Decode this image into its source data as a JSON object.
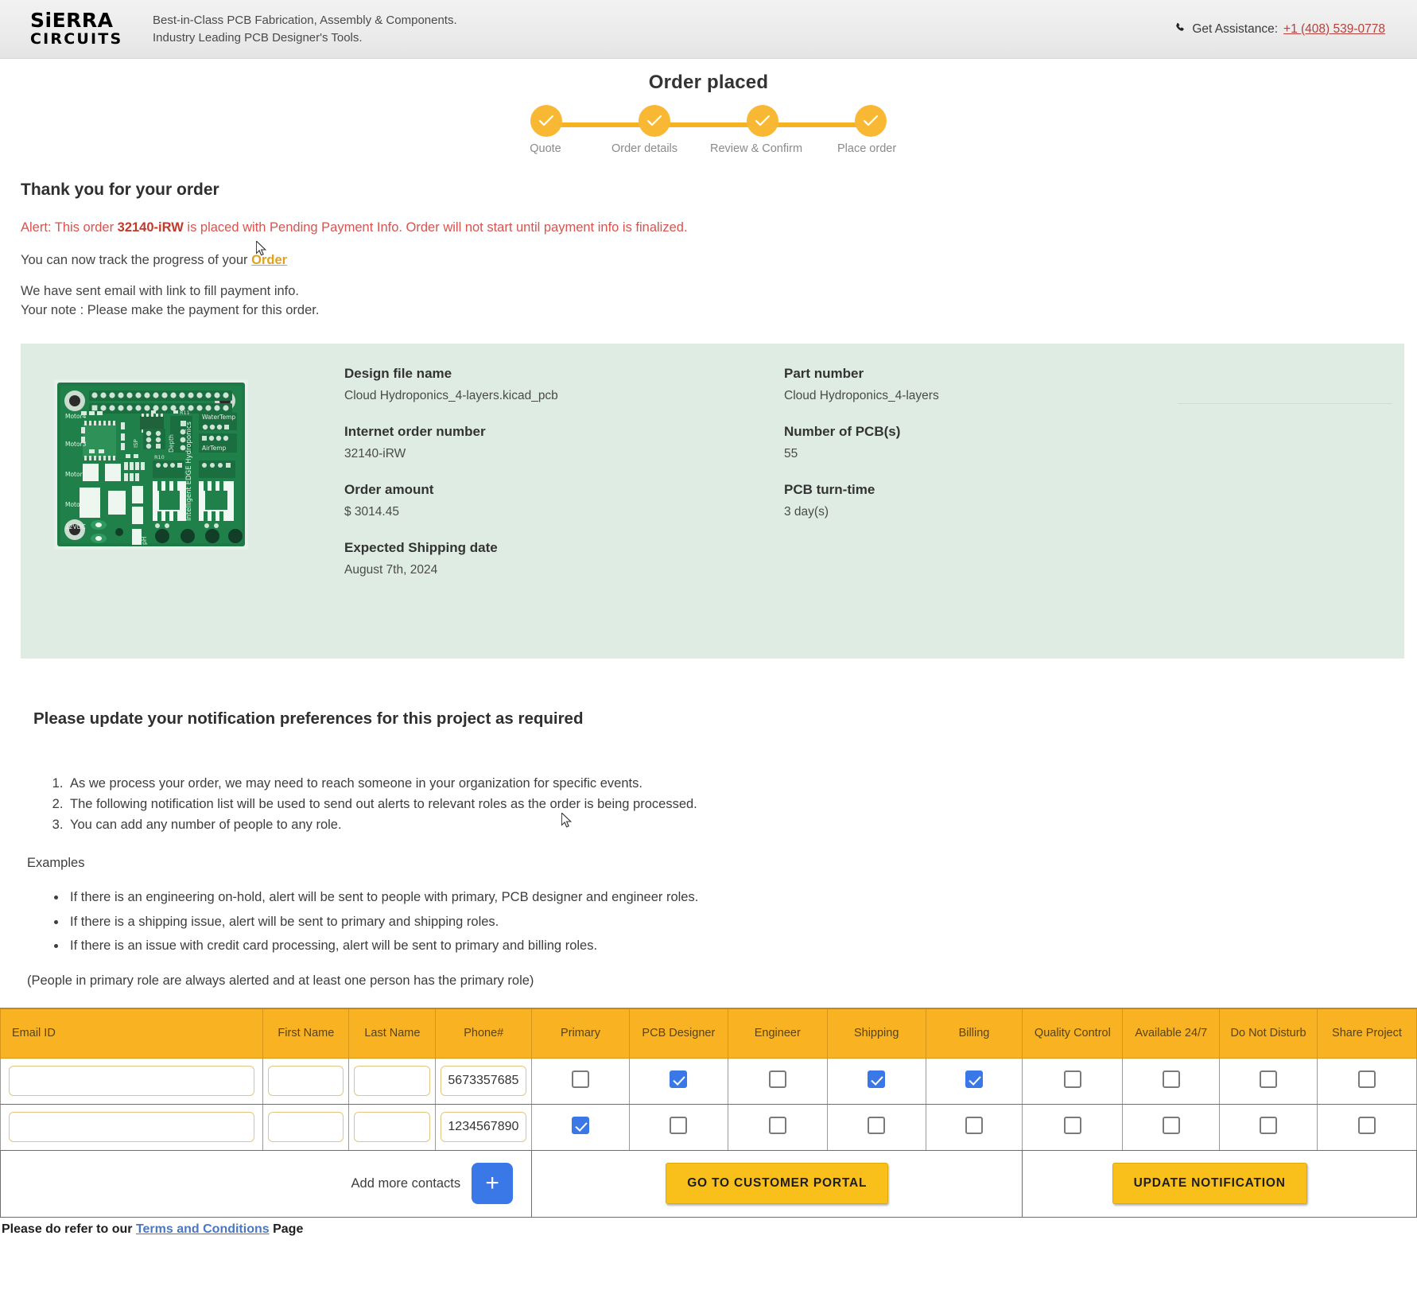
{
  "header": {
    "logo_line1": "SiERRA",
    "logo_line2": "CIRCUITS",
    "tagline_1": "Best-in-Class PCB Fabrication, Assembly & Components.",
    "tagline_2": "Industry Leading PCB Designer's Tools.",
    "assist_label": "Get Assistance:",
    "assist_phone": "+1 (408) 539-0778",
    "phone_icon": "phone-icon"
  },
  "stepper": {
    "title": "Order placed",
    "steps": [
      {
        "label": "Quote",
        "complete": true
      },
      {
        "label": "Order details",
        "complete": true
      },
      {
        "label": "Review & Confirm",
        "complete": true
      },
      {
        "label": "Place order",
        "complete": true
      }
    ]
  },
  "summary": {
    "thanks_heading": "Thank you for your order",
    "alert_prefix": "Alert: This order ",
    "alert_order_id": "32140-iRW",
    "alert_suffix": " is placed with Pending Payment Info. Order will not start until payment info is finalized.",
    "track_prefix": "You can now track the progress of your ",
    "track_link": "Order",
    "email_line": "We have sent email with link to fill payment info.",
    "note_line": "Your note : Please make the payment for this order."
  },
  "details": {
    "left": [
      {
        "label": "Design file name",
        "value": "Cloud Hydroponics_4-layers.kicad_pcb"
      },
      {
        "label": "Internet order number",
        "value": "32140-iRW"
      },
      {
        "label": "Order amount",
        "value": "$ 3014.45"
      },
      {
        "label": "Expected Shipping date",
        "value": "August 7th, 2024"
      }
    ],
    "right": [
      {
        "label": "Part number",
        "value": "Cloud Hydroponics_4-layers"
      },
      {
        "label": "Number of PCB(s)",
        "value": "55"
      },
      {
        "label": "PCB turn-time",
        "value": "3 day(s)"
      }
    ],
    "thumbnail_name": "pcb-board-preview-image"
  },
  "preferences": {
    "title": "Please update your notification preferences for this project as required",
    "numbered": [
      "As we process your order, we may need to reach someone in your organization for specific events.",
      "The following notification list will be used to send out alerts to relevant roles as the order is being processed.",
      "You can add any number of people to any role."
    ],
    "examples_heading": "Examples",
    "examples": [
      "If there is an engineering on-hold, alert will be sent to people with primary, PCB designer and engineer roles.",
      "If there is a shipping issue, alert will be sent to primary and shipping roles.",
      "If there is an issue with credit card processing, alert will be sent to primary and billing roles."
    ],
    "primary_note": "(People in primary role are always alerted and at least one person has the primary role)"
  },
  "table": {
    "columns": [
      "Email ID",
      "First Name",
      "Last Name",
      "Phone#",
      "Primary",
      "PCB Designer",
      "Engineer",
      "Shipping",
      "Billing",
      "Quality Control",
      "Available 24/7",
      "Do Not Disturb",
      "Share Project"
    ],
    "rows": [
      {
        "email": "",
        "first_name": "",
        "last_name": "",
        "phone": "5673357685",
        "primary": false,
        "pcb_designer": true,
        "engineer": false,
        "shipping": true,
        "billing": true,
        "quality_control": false,
        "available_247": false,
        "do_not_disturb": false,
        "share_project": false
      },
      {
        "email": "",
        "first_name": "",
        "last_name": "",
        "phone": "1234567890",
        "primary": true,
        "pcb_designer": false,
        "engineer": false,
        "shipping": false,
        "billing": false,
        "quality_control": false,
        "available_247": false,
        "do_not_disturb": false,
        "share_project": false
      }
    ]
  },
  "actions": {
    "add_contacts_label": "Add more contacts",
    "add_contacts_icon": "plus-icon",
    "customer_portal_label": "GO TO CUSTOMER PORTAL",
    "update_notification_label": "UPDATE NOTIFICATION"
  },
  "footer": {
    "terms_prefix": "Please do refer to our ",
    "terms_link": "Terms and Conditions",
    "terms_suffix": " Page"
  },
  "colors": {
    "brand_yellow": "#f9b222",
    "alert_red": "#d9534f",
    "panel_green": "#dfece4",
    "checkbox_blue": "#3b78e7"
  }
}
